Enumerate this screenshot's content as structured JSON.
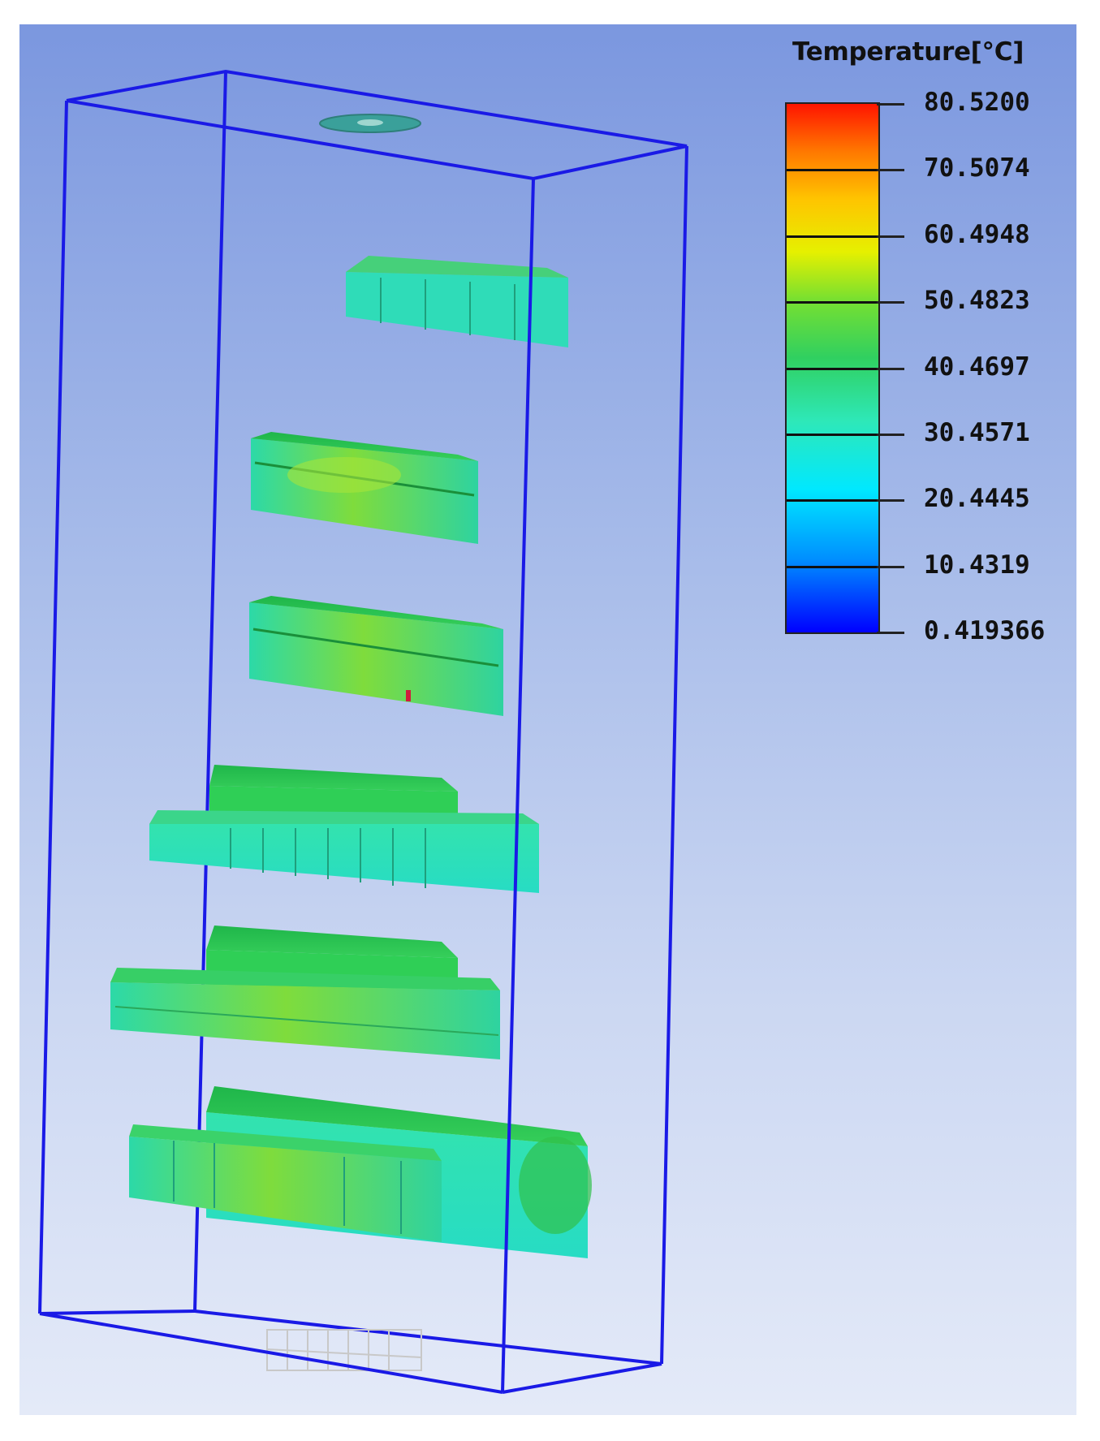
{
  "legend": {
    "title": "Temperature[°C]",
    "ticks": [
      "80.5200",
      "70.5074",
      "60.4948",
      "50.4823",
      "40.4697",
      "30.4571",
      "20.4445",
      "10.4319",
      "0.419366"
    ],
    "colormap": [
      "#0000ff",
      "#0090ff",
      "#00e8ff",
      "#2ee8b8",
      "#30d060",
      "#78e030",
      "#e6f000",
      "#ffc400",
      "#ff7800",
      "#ff1400"
    ]
  },
  "colors": {
    "frame": "#1a1ae6",
    "component_main": "#2fd9a0",
    "component_warm": "#3fcf4a",
    "component_hot": "#8ee03a"
  },
  "icons": {
    "top_vent": "fan-outlet-icon",
    "bottom_vent": "inlet-grille-icon"
  }
}
